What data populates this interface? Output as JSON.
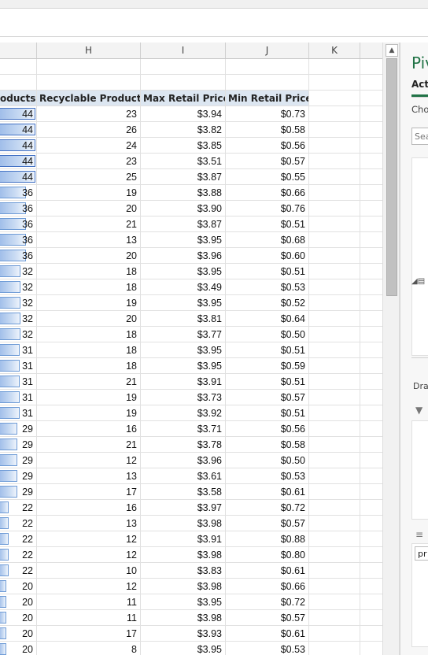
{
  "columns": {
    "h": "H",
    "i": "I",
    "j": "J",
    "k": "K"
  },
  "table": {
    "headers": {
      "g": "oducts",
      "h": "Recyclable Products",
      "i": "Max Retail Price",
      "j": "Min Retail Price"
    },
    "rows": [
      {
        "g": "44",
        "h": "23",
        "i": "$3.94",
        "j": "$0.73"
      },
      {
        "g": "44",
        "h": "26",
        "i": "$3.82",
        "j": "$0.58"
      },
      {
        "g": "44",
        "h": "24",
        "i": "$3.85",
        "j": "$0.56"
      },
      {
        "g": "44",
        "h": "23",
        "i": "$3.51",
        "j": "$0.57"
      },
      {
        "g": "44",
        "h": "25",
        "i": "$3.87",
        "j": "$0.55"
      },
      {
        "g": "36",
        "h": "19",
        "i": "$3.88",
        "j": "$0.66"
      },
      {
        "g": "36",
        "h": "20",
        "i": "$3.90",
        "j": "$0.76"
      },
      {
        "g": "36",
        "h": "21",
        "i": "$3.87",
        "j": "$0.51"
      },
      {
        "g": "36",
        "h": "13",
        "i": "$3.95",
        "j": "$0.68"
      },
      {
        "g": "36",
        "h": "20",
        "i": "$3.96",
        "j": "$0.60"
      },
      {
        "g": "32",
        "h": "18",
        "i": "$3.95",
        "j": "$0.51"
      },
      {
        "g": "32",
        "h": "18",
        "i": "$3.49",
        "j": "$0.53"
      },
      {
        "g": "32",
        "h": "19",
        "i": "$3.95",
        "j": "$0.52"
      },
      {
        "g": "32",
        "h": "20",
        "i": "$3.81",
        "j": "$0.64"
      },
      {
        "g": "32",
        "h": "18",
        "i": "$3.77",
        "j": "$0.50"
      },
      {
        "g": "31",
        "h": "18",
        "i": "$3.95",
        "j": "$0.51"
      },
      {
        "g": "31",
        "h": "18",
        "i": "$3.95",
        "j": "$0.59"
      },
      {
        "g": "31",
        "h": "21",
        "i": "$3.91",
        "j": "$0.51"
      },
      {
        "g": "31",
        "h": "19",
        "i": "$3.73",
        "j": "$0.57"
      },
      {
        "g": "31",
        "h": "19",
        "i": "$3.92",
        "j": "$0.51"
      },
      {
        "g": "29",
        "h": "16",
        "i": "$3.71",
        "j": "$0.56"
      },
      {
        "g": "29",
        "h": "21",
        "i": "$3.78",
        "j": "$0.58"
      },
      {
        "g": "29",
        "h": "12",
        "i": "$3.96",
        "j": "$0.50"
      },
      {
        "g": "29",
        "h": "13",
        "i": "$3.61",
        "j": "$0.53"
      },
      {
        "g": "29",
        "h": "17",
        "i": "$3.58",
        "j": "$0.61"
      },
      {
        "g": "22",
        "h": "16",
        "i": "$3.97",
        "j": "$0.72"
      },
      {
        "g": "22",
        "h": "13",
        "i": "$3.98",
        "j": "$0.57"
      },
      {
        "g": "22",
        "h": "12",
        "i": "$3.91",
        "j": "$0.88"
      },
      {
        "g": "22",
        "h": "12",
        "i": "$3.98",
        "j": "$0.80"
      },
      {
        "g": "22",
        "h": "10",
        "i": "$3.83",
        "j": "$0.61"
      },
      {
        "g": "20",
        "h": "12",
        "i": "$3.98",
        "j": "$0.66"
      },
      {
        "g": "20",
        "h": "11",
        "i": "$3.95",
        "j": "$0.72"
      },
      {
        "g": "20",
        "h": "11",
        "i": "$3.98",
        "j": "$0.57"
      },
      {
        "g": "20",
        "h": "17",
        "i": "$3.93",
        "j": "$0.61"
      },
      {
        "g": "20",
        "h": "8",
        "i": "$3.95",
        "j": "$0.53"
      }
    ]
  },
  "pane": {
    "title": "Piv",
    "tab": "Acti",
    "choose": "Cho",
    "search_placeholder": "Sear",
    "drag_label": "Dra",
    "row_item": "pr"
  },
  "colors": {
    "databar": "#9fbde9",
    "header_fill": "#dce6f1",
    "accent": "#217346"
  }
}
